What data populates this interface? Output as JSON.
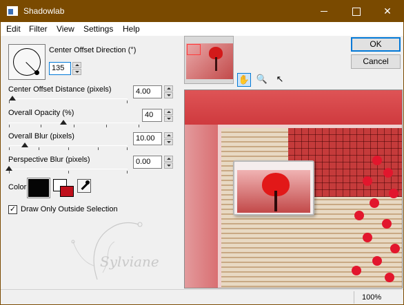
{
  "window": {
    "title": "Shadowlab"
  },
  "titlebar": {
    "minimize": "—",
    "maximize": "☐",
    "close": "✕"
  },
  "menu": [
    "Edit",
    "Filter",
    "View",
    "Settings",
    "Help"
  ],
  "controls": {
    "direction": {
      "label": "Center Offset Direction (°)",
      "value": "135"
    },
    "distance": {
      "label": "Center Offset Distance (pixels)",
      "value": "4.00"
    },
    "opacity": {
      "label": "Overall Opacity (%)",
      "value": "40"
    },
    "blur": {
      "label": "Overall Blur (pixels)",
      "value": "10.00"
    },
    "perspective": {
      "label": "Perspective Blur (pixels)",
      "value": "0.00"
    },
    "color": {
      "label": "Color",
      "shadow_color": "#050505",
      "fg": "#ffffff",
      "bg": "#c0101c"
    },
    "outside": {
      "label": "Draw Only Outside Selection",
      "checked": true,
      "check_glyph": "✓"
    }
  },
  "watermark": {
    "text": "Sylviane"
  },
  "tools": {
    "pan": "✋",
    "zoom": "🔍",
    "select": "↖"
  },
  "buttons": {
    "ok": "OK",
    "cancel": "Cancel"
  },
  "status": {
    "zoom": "100%"
  },
  "colors": {
    "accent": "#0078d7",
    "titlebar": "#7a4a00"
  }
}
